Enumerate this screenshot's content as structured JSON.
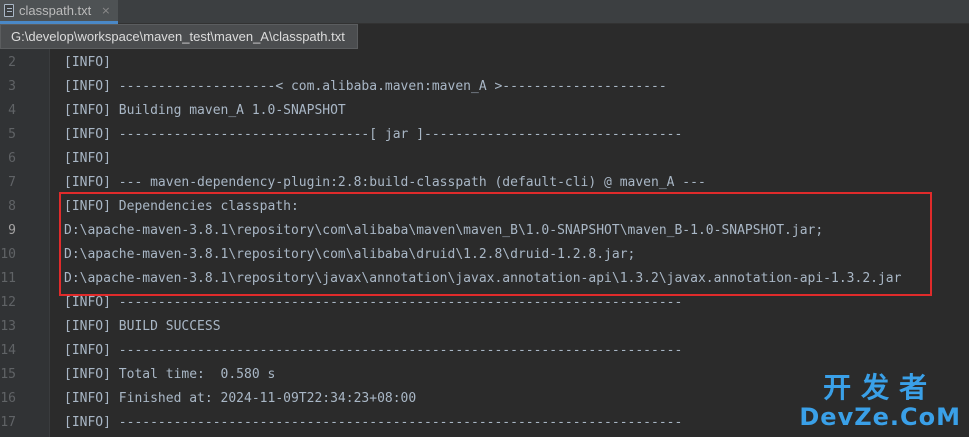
{
  "tab": {
    "title": "classpath.txt",
    "icon": "text-file-icon",
    "close": "×"
  },
  "tooltip": {
    "path": "G:\\develop\\workspace\\maven_test\\maven_A\\classpath.txt"
  },
  "editor": {
    "current_line": "9",
    "lines": [
      {
        "num": "2",
        "text": "[INFO]"
      },
      {
        "num": "3",
        "text": "[INFO] --------------------< com.alibaba.maven:maven_A >---------------------"
      },
      {
        "num": "4",
        "text": "[INFO] Building maven_A 1.0-SNAPSHOT"
      },
      {
        "num": "5",
        "text": "[INFO] --------------------------------[ jar ]---------------------------------"
      },
      {
        "num": "6",
        "text": "[INFO]"
      },
      {
        "num": "7",
        "text": "[INFO] --- maven-dependency-plugin:2.8:build-classpath (default-cli) @ maven_A ---"
      },
      {
        "num": "8",
        "text": "[INFO] Dependencies classpath:"
      },
      {
        "num": "9",
        "text": "D:\\apache-maven-3.8.1\\repository\\com\\alibaba\\maven\\maven_B\\1.0-SNAPSHOT\\maven_B-1.0-SNAPSHOT.jar;"
      },
      {
        "num": "10",
        "text": "D:\\apache-maven-3.8.1\\repository\\com\\alibaba\\druid\\1.2.8\\druid-1.2.8.jar;"
      },
      {
        "num": "11",
        "text": "D:\\apache-maven-3.8.1\\repository\\javax\\annotation\\javax.annotation-api\\1.3.2\\javax.annotation-api-1.3.2.jar"
      },
      {
        "num": "12",
        "text": "[INFO] ------------------------------------------------------------------------"
      },
      {
        "num": "13",
        "text": "[INFO] BUILD SUCCESS"
      },
      {
        "num": "14",
        "text": "[INFO] ------------------------------------------------------------------------"
      },
      {
        "num": "15",
        "text": "[INFO] Total time:  0.580 s"
      },
      {
        "num": "16",
        "text": "[INFO] Finished at: 2024-11-09T22:34:23+08:00"
      },
      {
        "num": "17",
        "text": "[INFO] ------------------------------------------------------------------------"
      }
    ]
  },
  "watermark": {
    "top": "开发者",
    "bottom": "DevZe.CoM"
  },
  "colors": {
    "highlight_border": "#e02b2b",
    "watermark": "#3aa0e8",
    "text": "#a9b7c6",
    "background": "#2b2b2b"
  }
}
